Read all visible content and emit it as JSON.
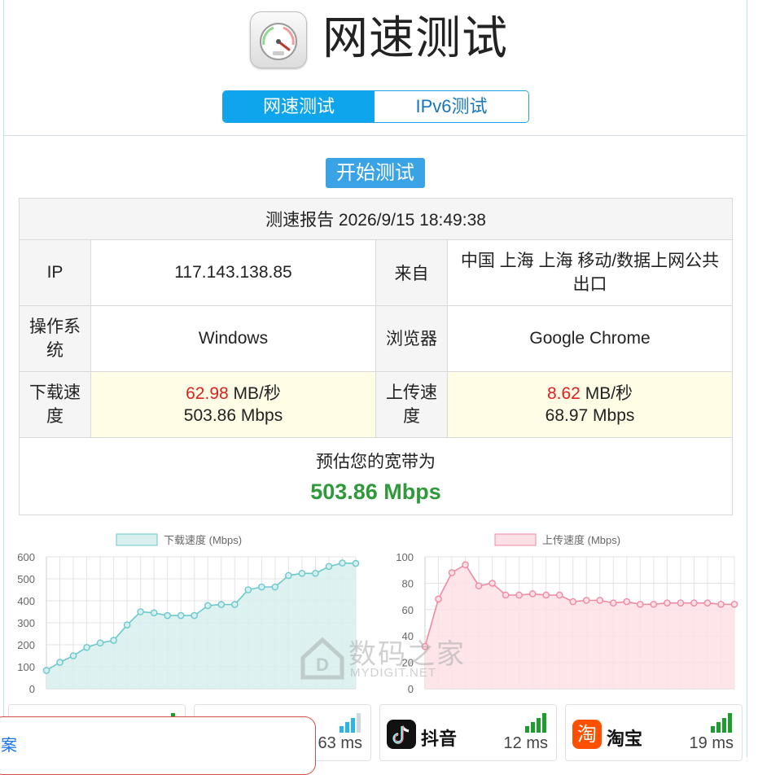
{
  "header": {
    "title": "网速测试"
  },
  "tabs": [
    {
      "label": "网速测试",
      "active": true
    },
    {
      "label": "IPv6测试",
      "active": false
    }
  ],
  "start_button": "开始测试",
  "report": {
    "heading": "测速报告 2026/9/15 18:49:38",
    "ip_label": "IP",
    "ip_value": "117.143.138.85",
    "from_label": "来自",
    "from_value": "中国 上海 上海 移动/数据上网公共出口",
    "os_label": "操作系统",
    "os_value": "Windows",
    "browser_label": "浏览器",
    "browser_value": "Google Chrome",
    "download_label": "下载速度",
    "download_mbs": "62.98",
    "download_unit": "MB/秒",
    "download_mbps": "503.86 Mbps",
    "upload_label": "上传速度",
    "upload_mbs": "8.62",
    "upload_unit": "MB/秒",
    "upload_mbps": "68.97 Mbps",
    "estimate_label": "预估您的宽带为",
    "estimate_value": "503.86 Mbps"
  },
  "colors": {
    "accent": "#0ea5ec",
    "download_line": "#6cc9cc",
    "download_fill": "#d7efef",
    "upload_line": "#f08aa0",
    "upload_fill": "#fde0e6",
    "estimate_green": "#2f9a3a",
    "speed_red": "#e02020"
  },
  "chart_data": [
    {
      "type": "area",
      "series": [
        {
          "name": "下载速度 (Mbps)",
          "values": [
            83,
            120,
            150,
            188,
            208,
            220,
            290,
            350,
            345,
            333,
            333,
            333,
            378,
            383,
            383,
            450,
            463,
            463,
            515,
            525,
            525,
            556,
            572,
            570
          ]
        }
      ],
      "ylim": [
        0,
        600
      ],
      "yticks": [
        "0",
        "100",
        "200",
        "300",
        "400",
        "500",
        "600"
      ],
      "grid": true,
      "legend": "top"
    },
    {
      "type": "area",
      "series": [
        {
          "name": "上传速度 (Mbps)",
          "values": [
            32,
            68,
            88,
            94,
            78,
            80,
            71,
            71,
            72,
            71,
            71,
            66,
            67,
            67,
            65,
            66,
            64,
            64,
            65,
            65,
            65,
            65,
            64,
            64
          ]
        }
      ],
      "ylim": [
        0,
        100
      ],
      "yticks": [
        "0",
        "20",
        "40",
        "60",
        "80",
        "100"
      ],
      "grid": true,
      "legend": "top"
    }
  ],
  "latency_cards": [
    {
      "name": "",
      "ms": ""
    },
    {
      "name": "",
      "ms": "63 ms"
    },
    {
      "name": "抖音",
      "ms": "12 ms"
    },
    {
      "name": "淘宝",
      "ms": "19 ms"
    }
  ],
  "overlay": {
    "text": "案"
  },
  "watermark": {
    "text": "数码之家",
    "subtext": "MYDIGIT.NET"
  }
}
